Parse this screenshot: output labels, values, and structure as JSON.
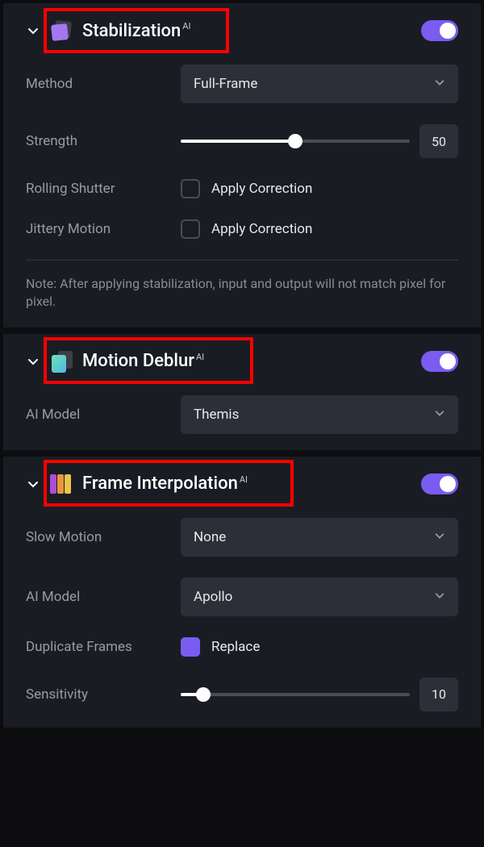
{
  "stabilization": {
    "title": "Stabilization",
    "ai_badge": "AI",
    "method_label": "Method",
    "method_value": "Full-Frame",
    "strength_label": "Strength",
    "strength_value": "50",
    "strength_percent": 50,
    "rolling_shutter_label": "Rolling Shutter",
    "rolling_shutter_check": "Apply Correction",
    "jittery_label": "Jittery Motion",
    "jittery_check": "Apply Correction",
    "note": "Note: After applying stabilization, input and output will not match pixel for pixel."
  },
  "deblur": {
    "title": "Motion Deblur",
    "ai_badge": "AI",
    "model_label": "AI Model",
    "model_value": "Themis"
  },
  "interpolation": {
    "title": "Frame Interpolation",
    "ai_badge": "AI",
    "slowmo_label": "Slow Motion",
    "slowmo_value": "None",
    "model_label": "AI Model",
    "model_value": "Apollo",
    "dup_label": "Duplicate Frames",
    "dup_check": "Replace",
    "sensitivity_label": "Sensitivity",
    "sensitivity_value": "10",
    "sensitivity_percent": 10
  }
}
